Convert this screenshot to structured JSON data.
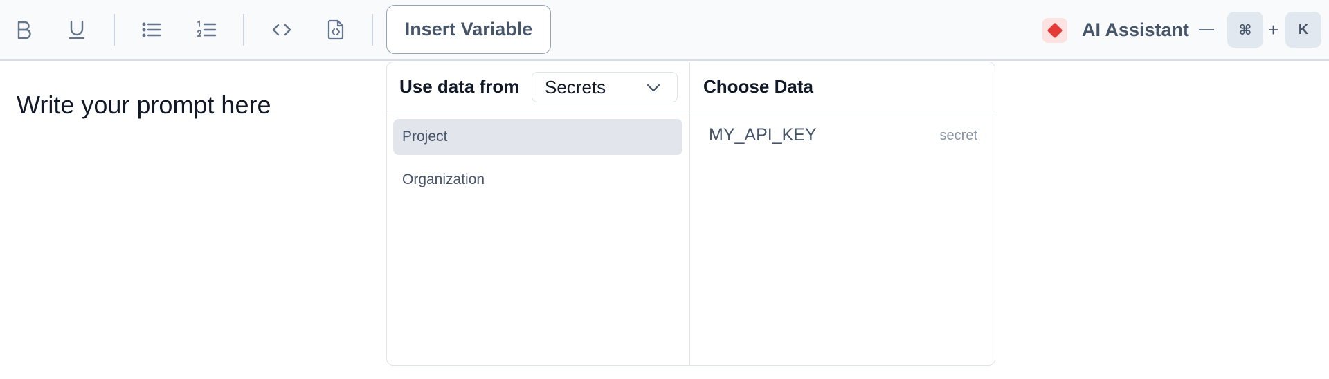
{
  "toolbar": {
    "icons": [
      {
        "name": "bold-icon"
      },
      {
        "name": "underline-icon"
      },
      {
        "name": "bullet-list-icon"
      },
      {
        "name": "numbered-list-icon"
      },
      {
        "name": "code-icon"
      },
      {
        "name": "code-file-icon"
      }
    ],
    "insert_variable_label": "Insert Variable",
    "ai_assistant_label": "AI Assistant",
    "shortcut": {
      "modifier": "⌘",
      "plus": "+",
      "key": "K"
    }
  },
  "editor": {
    "placeholder": "Write your prompt here"
  },
  "variable_picker": {
    "source_label": "Use data from",
    "source_select": {
      "selected": "Secrets"
    },
    "scopes": [
      {
        "label": "Project",
        "active": true
      },
      {
        "label": "Organization",
        "active": false
      }
    ],
    "choose_label": "Choose Data",
    "items": [
      {
        "name": "MY_API_KEY",
        "type": "secret"
      }
    ]
  },
  "colors": {
    "toolbar_bg": "#f8fafc",
    "text_muted": "#475569",
    "ai_accent": "#e53935",
    "active_item_bg": "#e2e6ec"
  }
}
